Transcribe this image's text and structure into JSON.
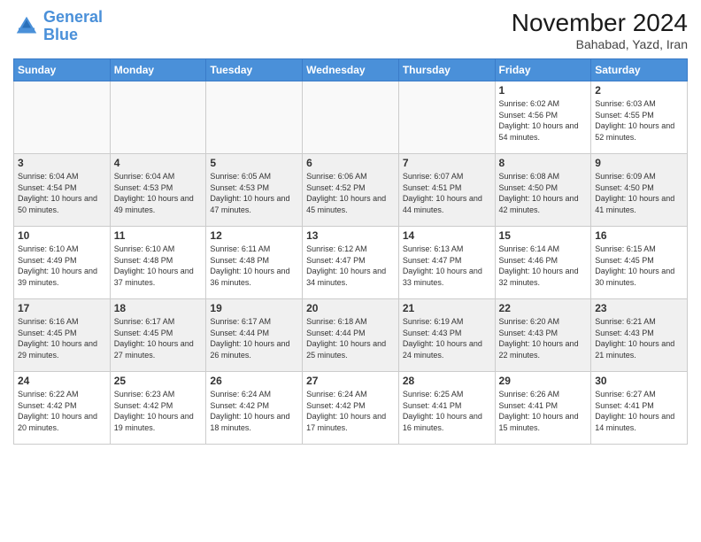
{
  "header": {
    "logo_line1": "General",
    "logo_line2": "Blue",
    "month_title": "November 2024",
    "location": "Bahabad, Yazd, Iran"
  },
  "weekdays": [
    "Sunday",
    "Monday",
    "Tuesday",
    "Wednesday",
    "Thursday",
    "Friday",
    "Saturday"
  ],
  "days": [
    {
      "date": "",
      "info": ""
    },
    {
      "date": "",
      "info": ""
    },
    {
      "date": "",
      "info": ""
    },
    {
      "date": "",
      "info": ""
    },
    {
      "date": "",
      "info": ""
    },
    {
      "date": "1",
      "info": "Sunrise: 6:02 AM\nSunset: 4:56 PM\nDaylight: 10 hours and 54 minutes."
    },
    {
      "date": "2",
      "info": "Sunrise: 6:03 AM\nSunset: 4:55 PM\nDaylight: 10 hours and 52 minutes."
    },
    {
      "date": "3",
      "info": "Sunrise: 6:04 AM\nSunset: 4:54 PM\nDaylight: 10 hours and 50 minutes."
    },
    {
      "date": "4",
      "info": "Sunrise: 6:04 AM\nSunset: 4:53 PM\nDaylight: 10 hours and 49 minutes."
    },
    {
      "date": "5",
      "info": "Sunrise: 6:05 AM\nSunset: 4:53 PM\nDaylight: 10 hours and 47 minutes."
    },
    {
      "date": "6",
      "info": "Sunrise: 6:06 AM\nSunset: 4:52 PM\nDaylight: 10 hours and 45 minutes."
    },
    {
      "date": "7",
      "info": "Sunrise: 6:07 AM\nSunset: 4:51 PM\nDaylight: 10 hours and 44 minutes."
    },
    {
      "date": "8",
      "info": "Sunrise: 6:08 AM\nSunset: 4:50 PM\nDaylight: 10 hours and 42 minutes."
    },
    {
      "date": "9",
      "info": "Sunrise: 6:09 AM\nSunset: 4:50 PM\nDaylight: 10 hours and 41 minutes."
    },
    {
      "date": "10",
      "info": "Sunrise: 6:10 AM\nSunset: 4:49 PM\nDaylight: 10 hours and 39 minutes."
    },
    {
      "date": "11",
      "info": "Sunrise: 6:10 AM\nSunset: 4:48 PM\nDaylight: 10 hours and 37 minutes."
    },
    {
      "date": "12",
      "info": "Sunrise: 6:11 AM\nSunset: 4:48 PM\nDaylight: 10 hours and 36 minutes."
    },
    {
      "date": "13",
      "info": "Sunrise: 6:12 AM\nSunset: 4:47 PM\nDaylight: 10 hours and 34 minutes."
    },
    {
      "date": "14",
      "info": "Sunrise: 6:13 AM\nSunset: 4:47 PM\nDaylight: 10 hours and 33 minutes."
    },
    {
      "date": "15",
      "info": "Sunrise: 6:14 AM\nSunset: 4:46 PM\nDaylight: 10 hours and 32 minutes."
    },
    {
      "date": "16",
      "info": "Sunrise: 6:15 AM\nSunset: 4:45 PM\nDaylight: 10 hours and 30 minutes."
    },
    {
      "date": "17",
      "info": "Sunrise: 6:16 AM\nSunset: 4:45 PM\nDaylight: 10 hours and 29 minutes."
    },
    {
      "date": "18",
      "info": "Sunrise: 6:17 AM\nSunset: 4:45 PM\nDaylight: 10 hours and 27 minutes."
    },
    {
      "date": "19",
      "info": "Sunrise: 6:17 AM\nSunset: 4:44 PM\nDaylight: 10 hours and 26 minutes."
    },
    {
      "date": "20",
      "info": "Sunrise: 6:18 AM\nSunset: 4:44 PM\nDaylight: 10 hours and 25 minutes."
    },
    {
      "date": "21",
      "info": "Sunrise: 6:19 AM\nSunset: 4:43 PM\nDaylight: 10 hours and 24 minutes."
    },
    {
      "date": "22",
      "info": "Sunrise: 6:20 AM\nSunset: 4:43 PM\nDaylight: 10 hours and 22 minutes."
    },
    {
      "date": "23",
      "info": "Sunrise: 6:21 AM\nSunset: 4:43 PM\nDaylight: 10 hours and 21 minutes."
    },
    {
      "date": "24",
      "info": "Sunrise: 6:22 AM\nSunset: 4:42 PM\nDaylight: 10 hours and 20 minutes."
    },
    {
      "date": "25",
      "info": "Sunrise: 6:23 AM\nSunset: 4:42 PM\nDaylight: 10 hours and 19 minutes."
    },
    {
      "date": "26",
      "info": "Sunrise: 6:24 AM\nSunset: 4:42 PM\nDaylight: 10 hours and 18 minutes."
    },
    {
      "date": "27",
      "info": "Sunrise: 6:24 AM\nSunset: 4:42 PM\nDaylight: 10 hours and 17 minutes."
    },
    {
      "date": "28",
      "info": "Sunrise: 6:25 AM\nSunset: 4:41 PM\nDaylight: 10 hours and 16 minutes."
    },
    {
      "date": "29",
      "info": "Sunrise: 6:26 AM\nSunset: 4:41 PM\nDaylight: 10 hours and 15 minutes."
    },
    {
      "date": "30",
      "info": "Sunrise: 6:27 AM\nSunset: 4:41 PM\nDaylight: 10 hours and 14 minutes."
    }
  ]
}
